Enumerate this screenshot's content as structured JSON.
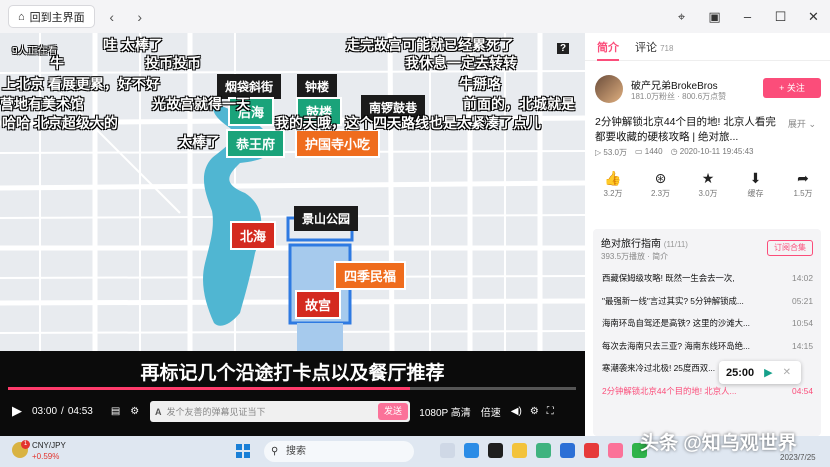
{
  "titlebar": {
    "home_label": "回到主界面",
    "back_icon": "chevron-left-icon",
    "forward_icon": "chevron-right-icon",
    "window_icons": [
      "pin-icon",
      "picture-in-picture-icon",
      "minimize-icon",
      "maximize-icon",
      "close-icon"
    ]
  },
  "video": {
    "viewers": "9人正在看",
    "help": "?",
    "subtitle": "再标记几个沿途打卡点以及餐厅推荐",
    "danmaku": [
      "哇  太棒了",
      "走完故宫可能就已经累死了",
      "牛",
      "投币投币",
      "我休息一定去转转",
      "上北京  看展更累，好不好",
      "牛掰咯",
      "营地有美术馆",
      "光故宫就得一天",
      "前面的，北城就是",
      "哈哈  北京超级大的",
      "我的天哦，这个四天路线也是太紧凑了点儿",
      "太棒了"
    ],
    "map_labels": {
      "yandai": "烟袋斜街",
      "zhonglou": "钟楼",
      "houhai": "后海",
      "gulou": "鼓楼",
      "nanluo": "南锣鼓巷",
      "gongwangfu": "恭王府",
      "huguosi": "护国寺小吃",
      "jingshan": "景山公园",
      "beihai": "北海",
      "siji": "四季民福",
      "gugong": "故宫"
    },
    "progress": 0.707,
    "time_current": "03:00",
    "time_sep": "/",
    "time_total": "04:53",
    "danmaku_placeholder": "发个友善的弹幕见证当下",
    "send_label": "发送",
    "quality": "1080P 高清",
    "speed": "倍速"
  },
  "panel": {
    "tab_intro": "简介",
    "tab_comments": "评论",
    "comments_count": "718",
    "author_name": "破产兄弟BrokeBros",
    "author_stats": "181.0万粉丝 · 800.6万点赞",
    "follow_label": "+ 关注",
    "title": "2分钟解锁北京44个目的地! 北京人看完都要收藏的硬核攻略 | 绝对旅...",
    "expand": "展开",
    "views": "53.0万",
    "danmaku_count": "1440",
    "pub_time": "2020-10-11 19:45:43",
    "actions": [
      {
        "icon": "thumbs-up-icon",
        "value": "3.2万"
      },
      {
        "icon": "coin-icon",
        "value": "2.3万"
      },
      {
        "icon": "star-icon",
        "value": "3.0万"
      },
      {
        "icon": "cache-download-icon",
        "value": "缓存"
      },
      {
        "icon": "share-icon",
        "value": "1.5万"
      }
    ],
    "playlist": {
      "title": "绝对旅行指南",
      "count": "(11/11)",
      "sub": "393.5万播放 · 简介",
      "subscribe": "订阅合集",
      "items": [
        {
          "title": "西藏保姆级攻略! 既然一生会去一次,",
          "dur": "14:02"
        },
        {
          "title": "\"最强新一线\"言过其实? 5分钟解锁成...",
          "dur": "05:21"
        },
        {
          "title": "海南环岛自驾还是高铁? 这里的沙滩大...",
          "dur": "10:54"
        },
        {
          "title": "每次去海南只去三亚? 海南东线环岛绝...",
          "dur": "14:15"
        },
        {
          "title": "寒潮袭来冷过北极! 25度西双...",
          "dur": ""
        },
        {
          "title": "2分钟解锁北京44个目的地! 北京人...",
          "dur": "04:54"
        }
      ]
    },
    "mini_time": "25:00"
  },
  "taskbar": {
    "badge": "1",
    "currency": "CNY/JPY",
    "change": "+0.59%",
    "search": "搜索",
    "watermark": "头条 @知乌观世界",
    "date": "2023/7/25"
  }
}
